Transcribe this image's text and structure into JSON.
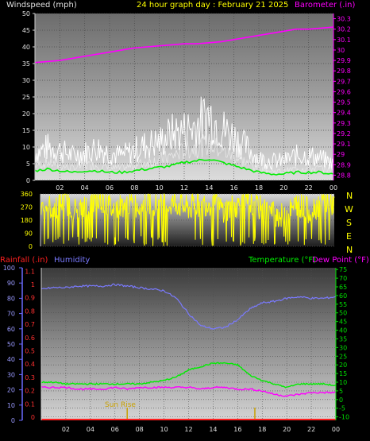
{
  "colors": {
    "wind": "#ffffff",
    "gust": "#ffffff",
    "wind_avg": "#00ee00",
    "barometer": "#ff00ff",
    "direction": "#ffff00",
    "rainfall": "#ff2020",
    "humidity": "#7a7aff",
    "temperature": "#00ee00",
    "dewpoint": "#ff00ff",
    "sun": "#c8a000",
    "axis_left": "#6a6aff",
    "axis_right": "#00dd00",
    "title": "#ffff00"
  },
  "header": {
    "windspeed_label": "Windspeed (mph)",
    "title": "24 hour graph day : February 21 2025",
    "barometer_label": "Barometer (.in)"
  },
  "direction_panel": {
    "compass": [
      "N",
      "W",
      "S",
      "E",
      "N"
    ]
  },
  "bottom_header": {
    "rainfall_label": "Rainfall (.in)",
    "humidity_label": "Humidity",
    "temperature_label": "Temperature (°F)",
    "dewpoint_label": "Dew Point (°F)"
  },
  "annotations": {
    "sun_rise": "Sun Rise"
  },
  "chart_data": [
    {
      "type": "line",
      "panel": "wind_barometer",
      "x_ticks": [
        "02",
        "04",
        "06",
        "08",
        "10",
        "12",
        "14",
        "16",
        "18",
        "20",
        "22",
        "00"
      ],
      "y_left_ticks": [
        0,
        5,
        10,
        15,
        20,
        25,
        30,
        35,
        40,
        45,
        50
      ],
      "y_right_ticks": [
        "28.8",
        "28.9",
        "29",
        "29.1",
        "29.2",
        "29.3",
        "29.4",
        "29.5",
        "29.6",
        "29.7",
        "29.8",
        "29.9",
        "30",
        "30.1",
        "30.2",
        "30.3"
      ],
      "ylim_left": [
        0,
        50
      ],
      "ylim_right": [
        28.75,
        30.35
      ],
      "xlim": [
        0,
        24
      ],
      "series": [
        {
          "name": "Windspeed",
          "x": [
            0,
            1,
            2,
            3,
            4,
            5,
            6,
            7,
            8,
            9,
            10,
            11,
            12,
            13,
            14,
            15,
            16,
            17,
            18,
            19,
            20,
            21,
            22,
            23,
            24
          ],
          "values": [
            5,
            6,
            5,
            4,
            5,
            5,
            4,
            4,
            5,
            6,
            7,
            8,
            10,
            11,
            12,
            10,
            8,
            6,
            4,
            3,
            3,
            4,
            4,
            4,
            3
          ]
        },
        {
          "name": "Gust",
          "x": [
            0,
            1,
            2,
            3,
            4,
            5,
            6,
            7,
            8,
            9,
            10,
            11,
            12,
            13,
            14,
            15,
            16,
            17,
            18,
            19,
            20,
            21,
            22,
            23,
            24
          ],
          "values": [
            10,
            12,
            11,
            9,
            10,
            12,
            10,
            9,
            11,
            13,
            14,
            17,
            18,
            20,
            24,
            19,
            16,
            12,
            8,
            7,
            7,
            9,
            9,
            8,
            6
          ]
        },
        {
          "name": "Barometer",
          "x": [
            0,
            1,
            2,
            3,
            4,
            5,
            6,
            7,
            8,
            9,
            10,
            11,
            12,
            13,
            14,
            15,
            16,
            17,
            18,
            19,
            20,
            21,
            22,
            23,
            24
          ],
          "values": [
            29.88,
            29.89,
            29.9,
            29.92,
            29.94,
            29.96,
            29.98,
            30.0,
            30.02,
            30.03,
            30.04,
            30.05,
            30.06,
            30.06,
            30.07,
            30.08,
            30.1,
            30.12,
            30.14,
            30.16,
            30.18,
            30.2,
            30.2,
            30.21,
            30.22
          ]
        }
      ]
    },
    {
      "type": "line",
      "panel": "wind_direction",
      "x_ticks": [
        "02",
        "04",
        "06",
        "08",
        "10",
        "12",
        "14",
        "16",
        "18",
        "20",
        "22",
        "00"
      ],
      "y_ticks": [
        0,
        90,
        180,
        270,
        360
      ],
      "ylim": [
        0,
        360
      ],
      "xlim": [
        0,
        24
      ],
      "series": [
        {
          "name": "Direction",
          "x": [
            0,
            1,
            2,
            3,
            4,
            5,
            6,
            7,
            8,
            9,
            10,
            11,
            12,
            13,
            14,
            15,
            16,
            17,
            18,
            19,
            20,
            21,
            22,
            23,
            24
          ],
          "values": [
            300,
            260,
            310,
            240,
            290,
            320,
            250,
            300,
            280,
            310,
            270,
            300,
            260,
            290,
            300,
            250,
            280,
            300,
            260,
            230,
            200,
            300,
            240,
            310,
            290
          ]
        }
      ]
    },
    {
      "type": "line",
      "panel": "humidity_temperature",
      "x_ticks": [
        "02",
        "04",
        "06",
        "08",
        "10",
        "12",
        "14",
        "16",
        "18",
        "20",
        "22",
        "00"
      ],
      "y_left_ticks": [
        0,
        10,
        20,
        30,
        40,
        50,
        60,
        70,
        80,
        90,
        100
      ],
      "y_rain_ticks": [
        "0",
        "0.1",
        "0.2",
        "0.3",
        "0.4",
        "0.5",
        "0.6",
        "0.7",
        "0.8",
        "0.9",
        "1",
        "1.1"
      ],
      "y_right_ticks": [
        -10,
        -5,
        0,
        5,
        10,
        15,
        20,
        25,
        30,
        35,
        40,
        45,
        50,
        55,
        60,
        65,
        70,
        75
      ],
      "ylim_left": [
        0,
        100
      ],
      "ylim_right": [
        -12,
        76
      ],
      "xlim": [
        0,
        24
      ],
      "series": [
        {
          "name": "Humidity",
          "x": [
            0,
            1,
            2,
            3,
            4,
            5,
            6,
            7,
            8,
            9,
            10,
            11,
            12,
            13,
            14,
            15,
            16,
            17,
            18,
            19,
            20,
            21,
            22,
            23,
            24
          ],
          "values": [
            86,
            87,
            87,
            88,
            88,
            88,
            89,
            88,
            87,
            86,
            85,
            80,
            70,
            62,
            60,
            61,
            66,
            73,
            77,
            78,
            80,
            81,
            80,
            80,
            81
          ]
        },
        {
          "name": "Temperature",
          "x": [
            0,
            1,
            2,
            3,
            4,
            5,
            6,
            7,
            8,
            9,
            10,
            11,
            12,
            13,
            14,
            15,
            16,
            17,
            18,
            19,
            20,
            21,
            22,
            23,
            24
          ],
          "values": [
            10,
            10,
            9,
            9,
            9,
            9,
            9,
            9,
            9,
            10,
            11,
            13,
            17,
            19,
            21,
            21,
            20,
            14,
            11,
            9,
            7,
            9,
            9,
            9,
            8
          ]
        },
        {
          "name": "Dew Point",
          "x": [
            0,
            1,
            2,
            3,
            4,
            5,
            6,
            7,
            8,
            9,
            10,
            11,
            12,
            13,
            14,
            15,
            16,
            17,
            18,
            19,
            20,
            21,
            22,
            23,
            24
          ],
          "values": [
            7,
            7,
            7,
            6,
            6,
            6,
            7,
            6,
            7,
            7,
            7,
            7,
            7,
            6,
            7,
            7,
            6,
            6,
            5,
            3,
            2,
            3,
            4,
            4,
            4
          ]
        },
        {
          "name": "Rainfall",
          "x": [
            0,
            24
          ],
          "values": [
            0,
            0
          ]
        }
      ],
      "sun_rise_x": 7.0,
      "sun_set_x": 17.4
    }
  ]
}
